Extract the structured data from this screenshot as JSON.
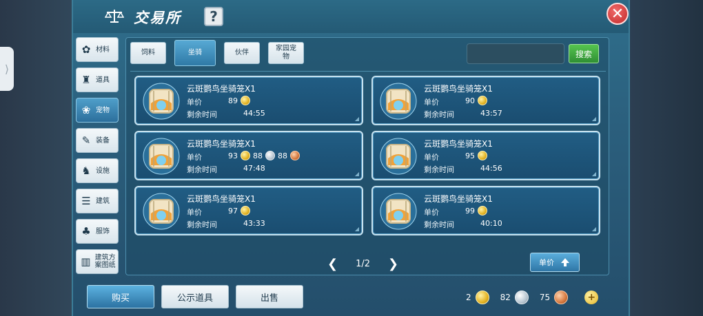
{
  "header": {
    "title": "交易所",
    "help_label": "?",
    "close_label": "✕"
  },
  "side_handle": "⟩",
  "sidebar": {
    "items": [
      {
        "label": "材料",
        "icon": "materials-icon",
        "glyph": "✿",
        "active": false
      },
      {
        "label": "道具",
        "icon": "props-icon",
        "glyph": "♜",
        "active": false
      },
      {
        "label": "宠物",
        "icon": "pet-paw-icon",
        "glyph": "❀",
        "active": true
      },
      {
        "label": "装备",
        "icon": "equipment-icon",
        "glyph": "✎",
        "active": false
      },
      {
        "label": "设施",
        "icon": "facility-icon",
        "glyph": "♞",
        "active": false
      },
      {
        "label": "建筑",
        "icon": "building-icon",
        "glyph": "☰",
        "active": false
      },
      {
        "label": "服饰",
        "icon": "clothing-icon",
        "glyph": "♣",
        "active": false
      },
      {
        "label": "建筑方案图纸",
        "icon": "blueprint-icon",
        "glyph": "▥",
        "active": false
      }
    ]
  },
  "tabs": [
    {
      "label": "饲料",
      "active": false
    },
    {
      "label": "坐骑",
      "active": true
    },
    {
      "label": "伙伴",
      "active": false
    },
    {
      "label": "家园宠物",
      "active": false
    }
  ],
  "search": {
    "value": "",
    "button_label": "搜索"
  },
  "listings": [
    {
      "name": "云斑鹦鸟坐骑笼X1",
      "price_label": "单价",
      "prices": [
        {
          "amount": "89",
          "currency": "gold"
        }
      ],
      "time_label": "剩余时间",
      "time": "44:55"
    },
    {
      "name": "云斑鹦鸟坐骑笼X1",
      "price_label": "单价",
      "prices": [
        {
          "amount": "90",
          "currency": "gold"
        }
      ],
      "time_label": "剩余时间",
      "time": "43:57"
    },
    {
      "name": "云斑鹦鸟坐骑笼X1",
      "price_label": "单价",
      "prices": [
        {
          "amount": "93",
          "currency": "gold"
        },
        {
          "amount": "88",
          "currency": "silver"
        },
        {
          "amount": "88",
          "currency": "copper"
        }
      ],
      "time_label": "剩余时间",
      "time": "47:48"
    },
    {
      "name": "云斑鹦鸟坐骑笼X1",
      "price_label": "单价",
      "prices": [
        {
          "amount": "95",
          "currency": "gold"
        }
      ],
      "time_label": "剩余时间",
      "time": "44:56"
    },
    {
      "name": "云斑鹦鸟坐骑笼X1",
      "price_label": "单价",
      "prices": [
        {
          "amount": "97",
          "currency": "gold"
        }
      ],
      "time_label": "剩余时间",
      "time": "43:33"
    },
    {
      "name": "云斑鹦鸟坐骑笼X1",
      "price_label": "单价",
      "prices": [
        {
          "amount": "99",
          "currency": "gold"
        }
      ],
      "time_label": "剩余时间",
      "time": "40:10"
    }
  ],
  "pager": {
    "prev": "❮",
    "page": "1/2",
    "next": "❯"
  },
  "sort": {
    "label": "单价"
  },
  "bottom": {
    "buy_label": "购买",
    "public_label": "公示道具",
    "sell_label": "出售",
    "gold": "2",
    "silver": "82",
    "copper": "75",
    "add_label": "+"
  },
  "colors": {
    "gold": "#e3b322",
    "silver": "#b9c7d2",
    "copper": "#d5793f",
    "accent": "#2f79a6",
    "confirm": "#2f8f34"
  }
}
